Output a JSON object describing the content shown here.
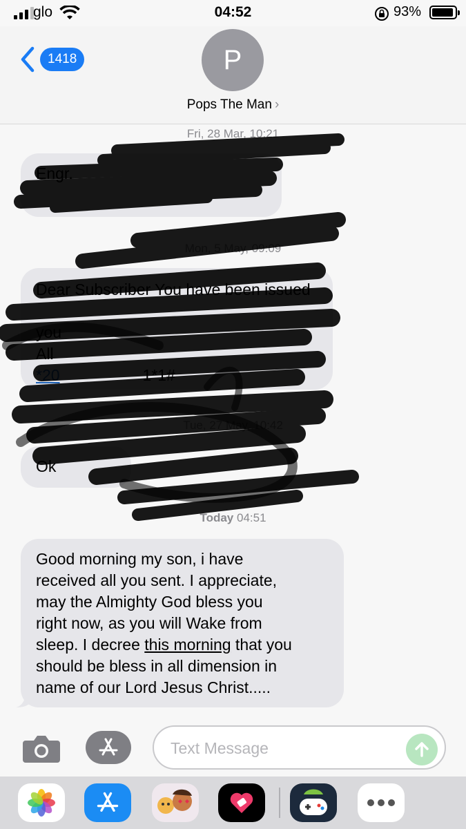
{
  "status_bar": {
    "carrier": "glo",
    "time": "04:52",
    "battery_percent": "93%",
    "battery_level": 0.93
  },
  "header": {
    "back_count": "1418",
    "avatar_initial": "P",
    "contact_name": "Pops The Man",
    "contact_chevron": "›"
  },
  "messages": {
    "ts1": "Fri, 28 Mar, 10:21",
    "msg1_visible": "Engr.",
    "ts2": "Mon, 5 May, 09:09",
    "msg2_line1": "Dear Subscriber You have been issued",
    "msg2_line3": "you",
    "msg2_line4": "All",
    "msg2_line5": "*20",
    "msg2_end": "1*1#",
    "ts3": "Tue, 27 May, 10:42",
    "msg3": "Ok",
    "ts4_day": "Today",
    "ts4_time": "04:51",
    "msg4": {
      "line1": "Good morning my son, i have",
      "line2": "received all you sent. I appreciate,",
      "line3": "may the Almighty God bless you",
      "line4": "right now, as you will Wake from",
      "line5_a": "sleep. I decree ",
      "line5_link": "this morning",
      "line5_b": " that you",
      "line6": "should be bless in all dimension in",
      "line7": "name of our Lord Jesus Christ....."
    }
  },
  "input_bar": {
    "placeholder": "Text Message"
  },
  "icons": {
    "camera": "camera-icon",
    "app_store": "app-store-icon",
    "send": "send-arrow-icon"
  },
  "app_drawer": [
    {
      "name": "photos-icon"
    },
    {
      "name": "app-store-icon"
    },
    {
      "name": "memoji-icon"
    },
    {
      "name": "digital-touch-icon"
    },
    {
      "name": "game-app-icon"
    },
    {
      "name": "more-apps-icon"
    }
  ],
  "colors": {
    "accent": "#1a7cf5",
    "bubble_gray": "#e6e6ea",
    "send_green": "#b8e6c0"
  }
}
